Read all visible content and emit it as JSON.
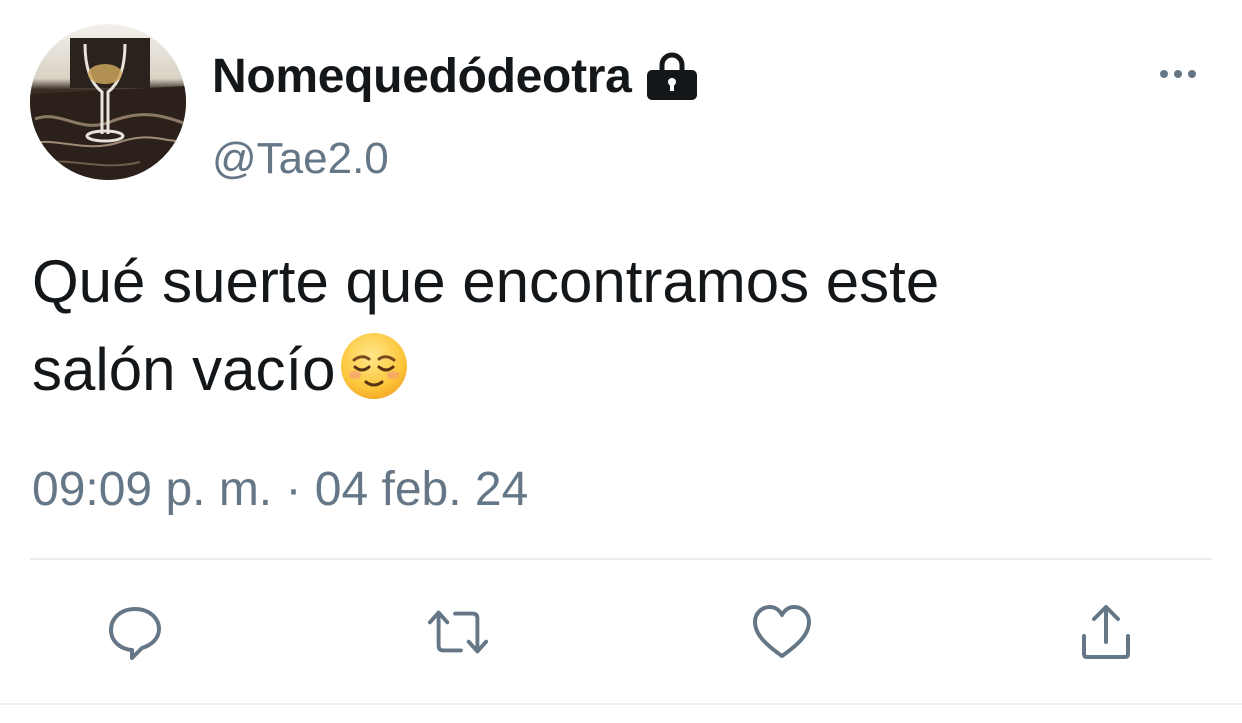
{
  "tweet": {
    "display_name": "Nomequedódeotra",
    "handle": "@Tae2.0",
    "text_line_1": "Qué suerte que encontramos este",
    "text_line_2": "salón vacío",
    "emoji": "relieved-face-emoji",
    "timestamp": "09:09 p. m. · 04 feb. 24",
    "protected_icon": "lock-icon",
    "more_icon": "more-options-icon"
  },
  "actions": [
    {
      "name": "reply",
      "icon": "reply-icon"
    },
    {
      "name": "retweet",
      "icon": "retweet-icon"
    },
    {
      "name": "like",
      "icon": "heart-icon"
    },
    {
      "name": "share",
      "icon": "share-icon"
    }
  ],
  "colors": {
    "text_primary": "#14171a",
    "text_secondary": "#657786",
    "icon_gray": "#657786",
    "divider": "#e6ecf0"
  }
}
